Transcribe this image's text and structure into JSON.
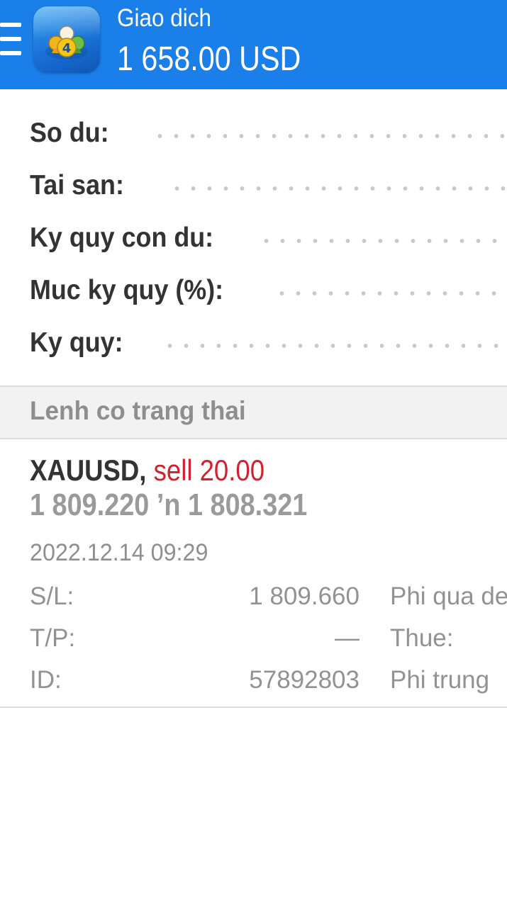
{
  "header": {
    "title": "Giao dich",
    "balance": "1 658.00 USD",
    "menu_icon": "hamburger-menu-icon",
    "app_icon": "metatrader-4-icon",
    "color": "#1a7fe8"
  },
  "summary": [
    {
      "label": "So du:"
    },
    {
      "label": "Tai san:"
    },
    {
      "label": "Ky quy con du:"
    },
    {
      "label": "Muc ky quy (%):"
    },
    {
      "label": "Ky quy:"
    }
  ],
  "section": {
    "label": "Lenh co trang thai"
  },
  "order": {
    "symbol": "XAUUSD,",
    "type": "sell 20.00",
    "type_color": "#d0232d",
    "prices": "1 809.220 ’n  1 808.321",
    "time": "2022.12.14 09:29",
    "details": [
      {
        "label": "S/L:",
        "value": "1 809.660",
        "right_label": "Phi qua de"
      },
      {
        "label": "T/P:",
        "value": "—",
        "right_label": "Thue:"
      },
      {
        "label": "ID:",
        "value": "57892803",
        "right_label": "Phi trung"
      }
    ]
  }
}
